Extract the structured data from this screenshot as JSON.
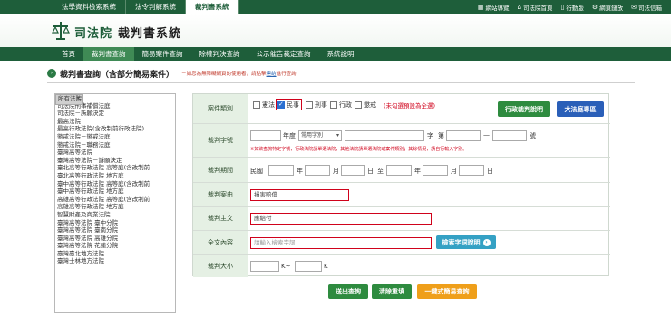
{
  "top_tabs": [
    "法學資料檢索系統",
    "法令判解系統",
    "裁判書系統"
  ],
  "top_links": [
    {
      "icon": "sitemap-icon",
      "label": "網站導覽"
    },
    {
      "icon": "home-icon",
      "label": "司法院首頁"
    },
    {
      "icon": "mobile-icon",
      "label": "行動版"
    },
    {
      "icon": "gear-icon",
      "label": "網頁鏈放"
    },
    {
      "icon": "mail-icon",
      "label": "司法信箱"
    }
  ],
  "brand": {
    "org": "司法院",
    "system": "裁判書系統"
  },
  "nav": [
    "首頁",
    "裁判書查詢",
    "簡易案件查詢",
    "除權判決查詢",
    "公示催告裁定查詢",
    "系統說明"
  ],
  "page": {
    "title": "裁判書查詢（含部分簡易案件）",
    "notice_prefix": "－如您為無障礙網頁的使用者，請點擊",
    "notice_link": "連結",
    "notice_suffix": "進行查詢"
  },
  "court_list": [
    "所有法院",
    "憲法法庭",
    "司法院刑事補償法庭",
    "司法院－訴願決定",
    "最高法院",
    "最高行政法院(含改制前行政法院)",
    "懲戒法院－懲戒法庭",
    "懲戒法院－職務法庭",
    "臺灣高等法院",
    "臺灣高等法院－訴願決定",
    "臺北高等行政法院 高等庭(含改制前",
    "臺北高等行政法院 地方庭",
    "臺中高等行政法院 高等庭(含改制前",
    "臺中高等行政法院 地方庭",
    "高雄高等行政法院 高等庭(含改制前",
    "高雄高等行政法院 地方庭",
    "智慧財產及商業法院",
    "臺灣高等法院 臺中分院",
    "臺灣高等法院 臺南分院",
    "臺灣高等法院 高雄分院",
    "臺灣高等法院 花蓮分院",
    "臺灣臺北地方法院",
    "臺灣士林地方法院"
  ],
  "form": {
    "case_type_label": "案件類別",
    "case_types": [
      {
        "label": "憲法",
        "checked": false
      },
      {
        "label": "民事",
        "checked": true
      },
      {
        "label": "刑事",
        "checked": false
      },
      {
        "label": "行政",
        "checked": false
      },
      {
        "label": "懲戒",
        "checked": false
      }
    ],
    "case_type_hint": "(未勾選預設為全選)",
    "btn_admin_help": "行政裁判說明",
    "btn_constitution": "大法庭專區",
    "case_no_label": "裁判字號",
    "year_unit": "年度",
    "word_select": "常用字別",
    "word_unit": "字",
    "no_label": "第",
    "dash": "—",
    "no_unit": "號",
    "case_no_hint": "※如欲查詢特定字號，行政法院請單選法院，其他法院請單選法院或案件類別；其餘情況，請自行輸入字別。",
    "date_label": "裁判期間",
    "era": "民國",
    "year": "年",
    "month": "月",
    "day": "日",
    "tilde": "至",
    "reason_label": "裁判案由",
    "reason_value": "損害賠償",
    "main_label": "裁判主文",
    "main_value": "應給付",
    "fulltext_label": "全文內容",
    "fulltext_placeholder": "請輸入檢索字詞",
    "btn_search_help": "檢索字詞說明",
    "size_label": "裁判大小",
    "size_unit_a": "K~",
    "size_unit_b": "K"
  },
  "actions": {
    "search": "送出查詢",
    "clear": "清除重填",
    "simple": "一鍵式簡易查詢"
  },
  "colors": {
    "brand_green": "#1e5e3a",
    "label_bg": "#e5f0e4",
    "highlight_red": "#d0021b"
  }
}
